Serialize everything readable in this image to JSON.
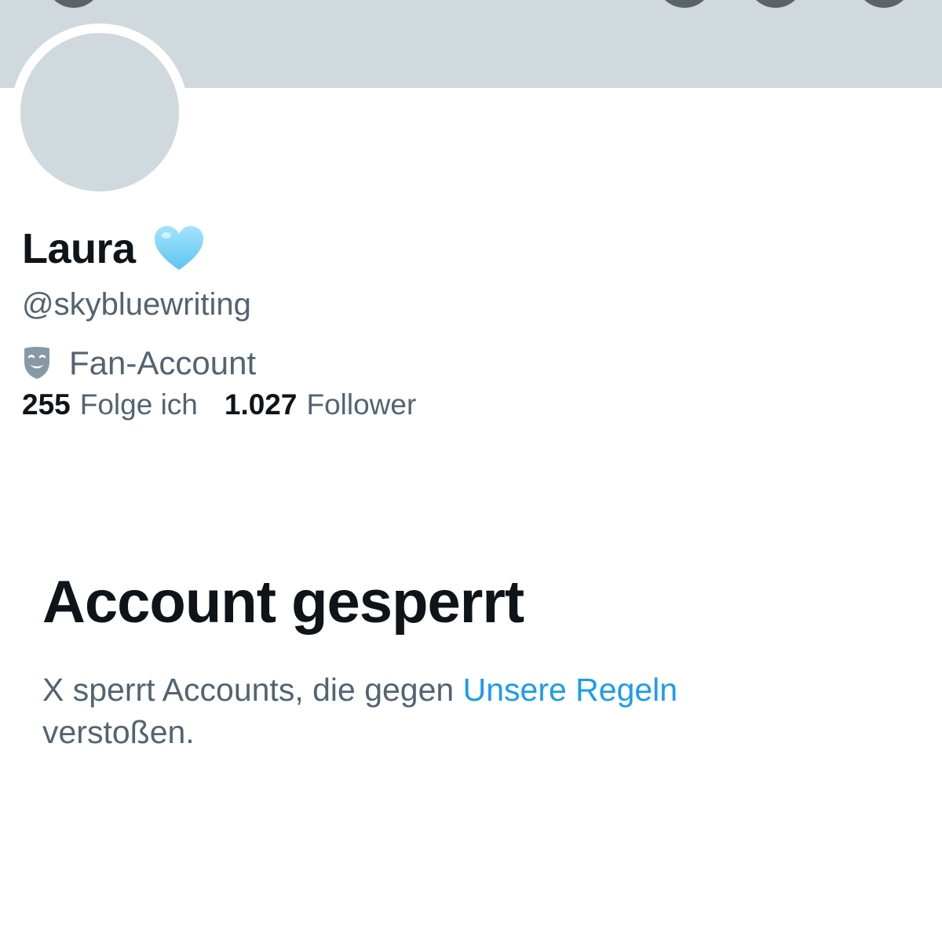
{
  "profile": {
    "display_name": "Laura",
    "name_emoji": "light-blue-heart-icon",
    "handle": "@skybluewriting",
    "category_icon": "theater-mask-icon",
    "category": "Fan-Account",
    "following_count": "255",
    "following_label": "Folge ich",
    "followers_count": "1.027",
    "followers_label": "Follower"
  },
  "suspended": {
    "title": "Account gesperrt",
    "desc_prefix": "X sperrt Accounts, die gegen ",
    "rules_link": "Unsere Regeln",
    "desc_suffix": " verstoßen."
  },
  "colors": {
    "banner": "#cfd9de",
    "avatar_placeholder": "#cfd9de",
    "primary_text": "#0f1419",
    "secondary_text": "#536471",
    "link": "#1d9bf0",
    "heart": "#7dd3f6"
  }
}
